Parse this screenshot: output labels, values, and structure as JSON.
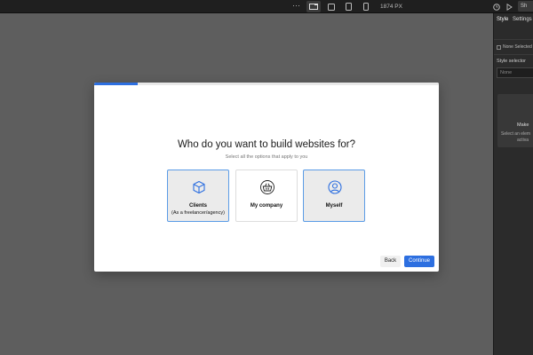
{
  "toolbar": {
    "more_label": "···",
    "canvas_width": "1874 PX",
    "share_label": "Sh"
  },
  "panel": {
    "tabs": [
      {
        "label": "Style"
      },
      {
        "label": "Settings"
      }
    ],
    "none_selected": "None Selected",
    "style_selector_label": "Style selector",
    "style_selector_placeholder": "None",
    "empty_title": "Make",
    "empty_hint_1": "Select an elem",
    "empty_hint_2": "activa"
  },
  "modal": {
    "progress": 0.125,
    "title": "Who do you want to build websites for?",
    "subtitle": "Select all the options that apply to you",
    "options": [
      {
        "label": "Clients",
        "sub": "(As a freelancer/agency)",
        "selected": true,
        "icon": "cube-icon"
      },
      {
        "label": "My company",
        "sub": "",
        "selected": false,
        "icon": "basket-icon"
      },
      {
        "label": "Myself",
        "sub": "",
        "selected": true,
        "icon": "user-circle-icon"
      }
    ],
    "back_label": "Back",
    "continue_label": "Continue"
  },
  "colors": {
    "accent": "#2d6fe0",
    "selected_border": "#5a9be6",
    "canvas_bg": "#5e5e5e",
    "topbar_bg": "#1f1f1f"
  }
}
